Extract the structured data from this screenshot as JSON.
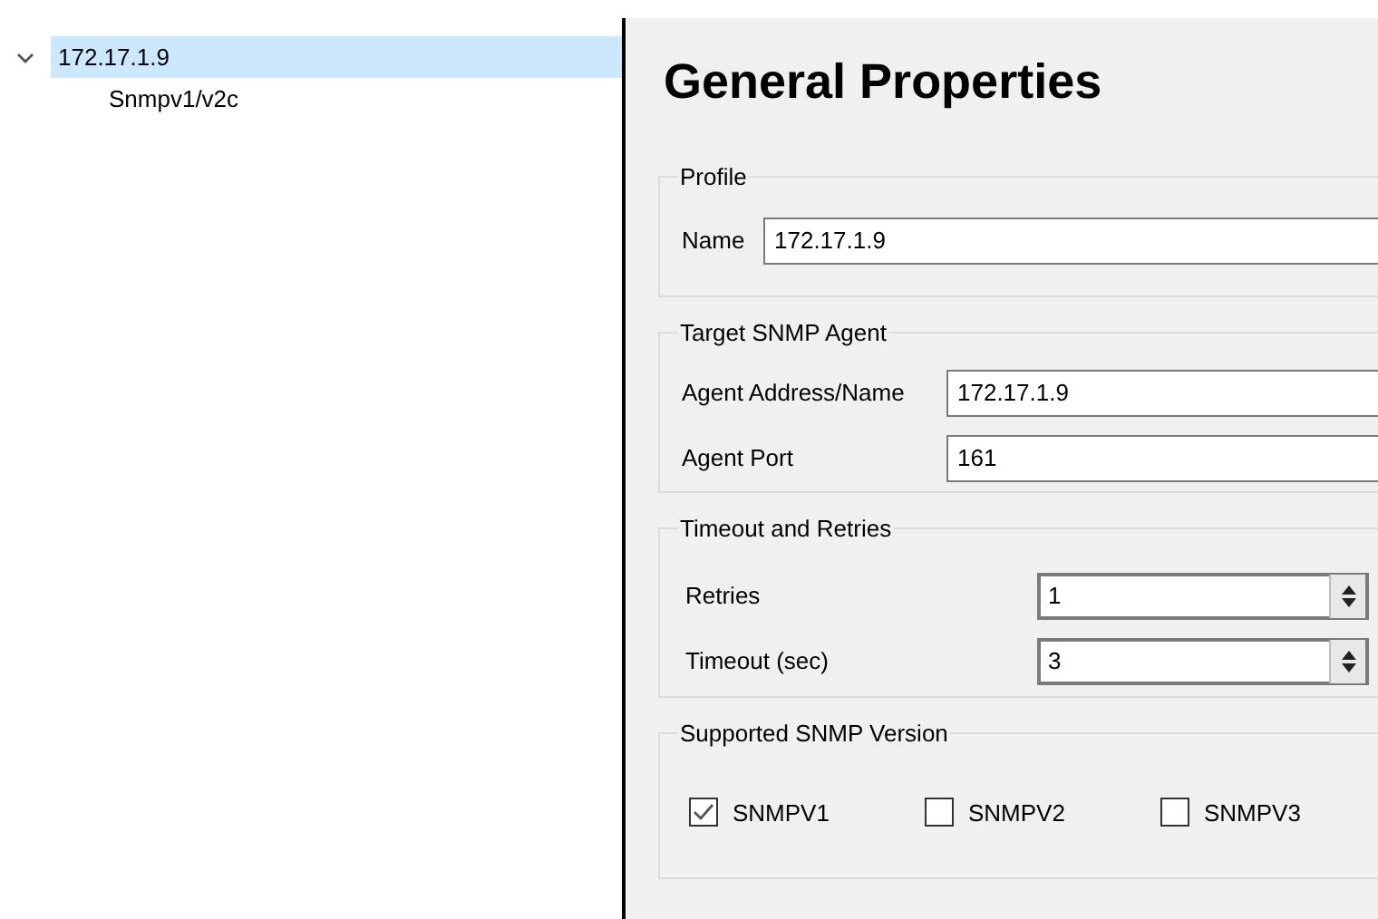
{
  "tree": [
    {
      "label": "172.17.1.9",
      "expanded": true,
      "selected": true,
      "children": [
        {
          "label": "Snmpv1/v2c",
          "selected": false
        }
      ]
    }
  ],
  "title": "General Properties",
  "groups": [
    {
      "legend": "Profile",
      "kind": "fields",
      "fields": [
        {
          "label": "Name",
          "value": "172.17.1.9"
        }
      ]
    },
    {
      "legend": "Target SNMP Agent",
      "kind": "fields",
      "fields": [
        {
          "label": "Agent Address/Name",
          "value": "172.17.1.9"
        },
        {
          "label": "Agent Port",
          "value": "161"
        }
      ]
    },
    {
      "legend": "Timeout and Retries",
      "kind": "spinners",
      "fields": [
        {
          "label": "Retries",
          "value": "1"
        },
        {
          "label": "Timeout (sec)",
          "value": "3"
        }
      ]
    },
    {
      "legend": "Supported SNMP Version",
      "kind": "checkboxes",
      "checkboxes": [
        {
          "label": "SNMPV1",
          "checked": true
        },
        {
          "label": "SNMPV2",
          "checked": false
        },
        {
          "label": "SNMPV3",
          "checked": false
        }
      ]
    }
  ]
}
